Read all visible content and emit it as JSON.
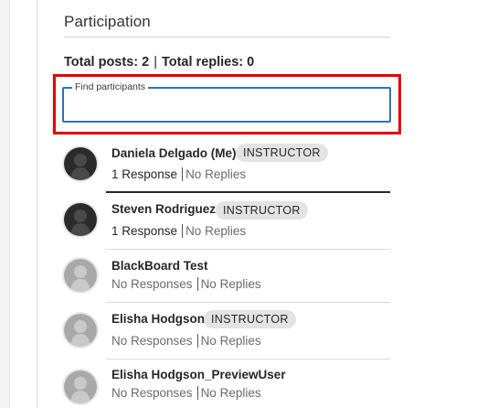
{
  "section": {
    "title": "Participation",
    "totals": {
      "posts": "Total posts: 2",
      "separator": "|",
      "replies": "Total replies: 0"
    }
  },
  "search": {
    "legend": "Find participants",
    "value": "",
    "placeholder": ""
  },
  "participants": [
    {
      "name": "Daniela Delgado (Me)",
      "badge": "INSTRUCTOR",
      "responses": "1 Response",
      "replies": "No Replies",
      "avatar": "dark"
    },
    {
      "name": "Steven Rodriguez",
      "badge": "INSTRUCTOR",
      "responses": "1 Response",
      "replies": "No Replies",
      "avatar": "dark"
    },
    {
      "name": "BlackBoard Test",
      "badge": "",
      "responses": "No Responses",
      "replies": "No Replies",
      "avatar": "light"
    },
    {
      "name": "Elisha Hodgson",
      "badge": "INSTRUCTOR",
      "responses": "No Responses",
      "replies": "No Replies",
      "avatar": "light"
    },
    {
      "name": "Elisha Hodgson_PreviewUser",
      "badge": "",
      "responses": "No Responses",
      "replies": "No Replies",
      "avatar": "light"
    }
  ],
  "colors": {
    "highlight": "#e00000",
    "focus_border": "#2f74ad",
    "badge_bg": "#e3e3e3"
  },
  "icons": {
    "avatar": "user-silhouette-icon"
  }
}
